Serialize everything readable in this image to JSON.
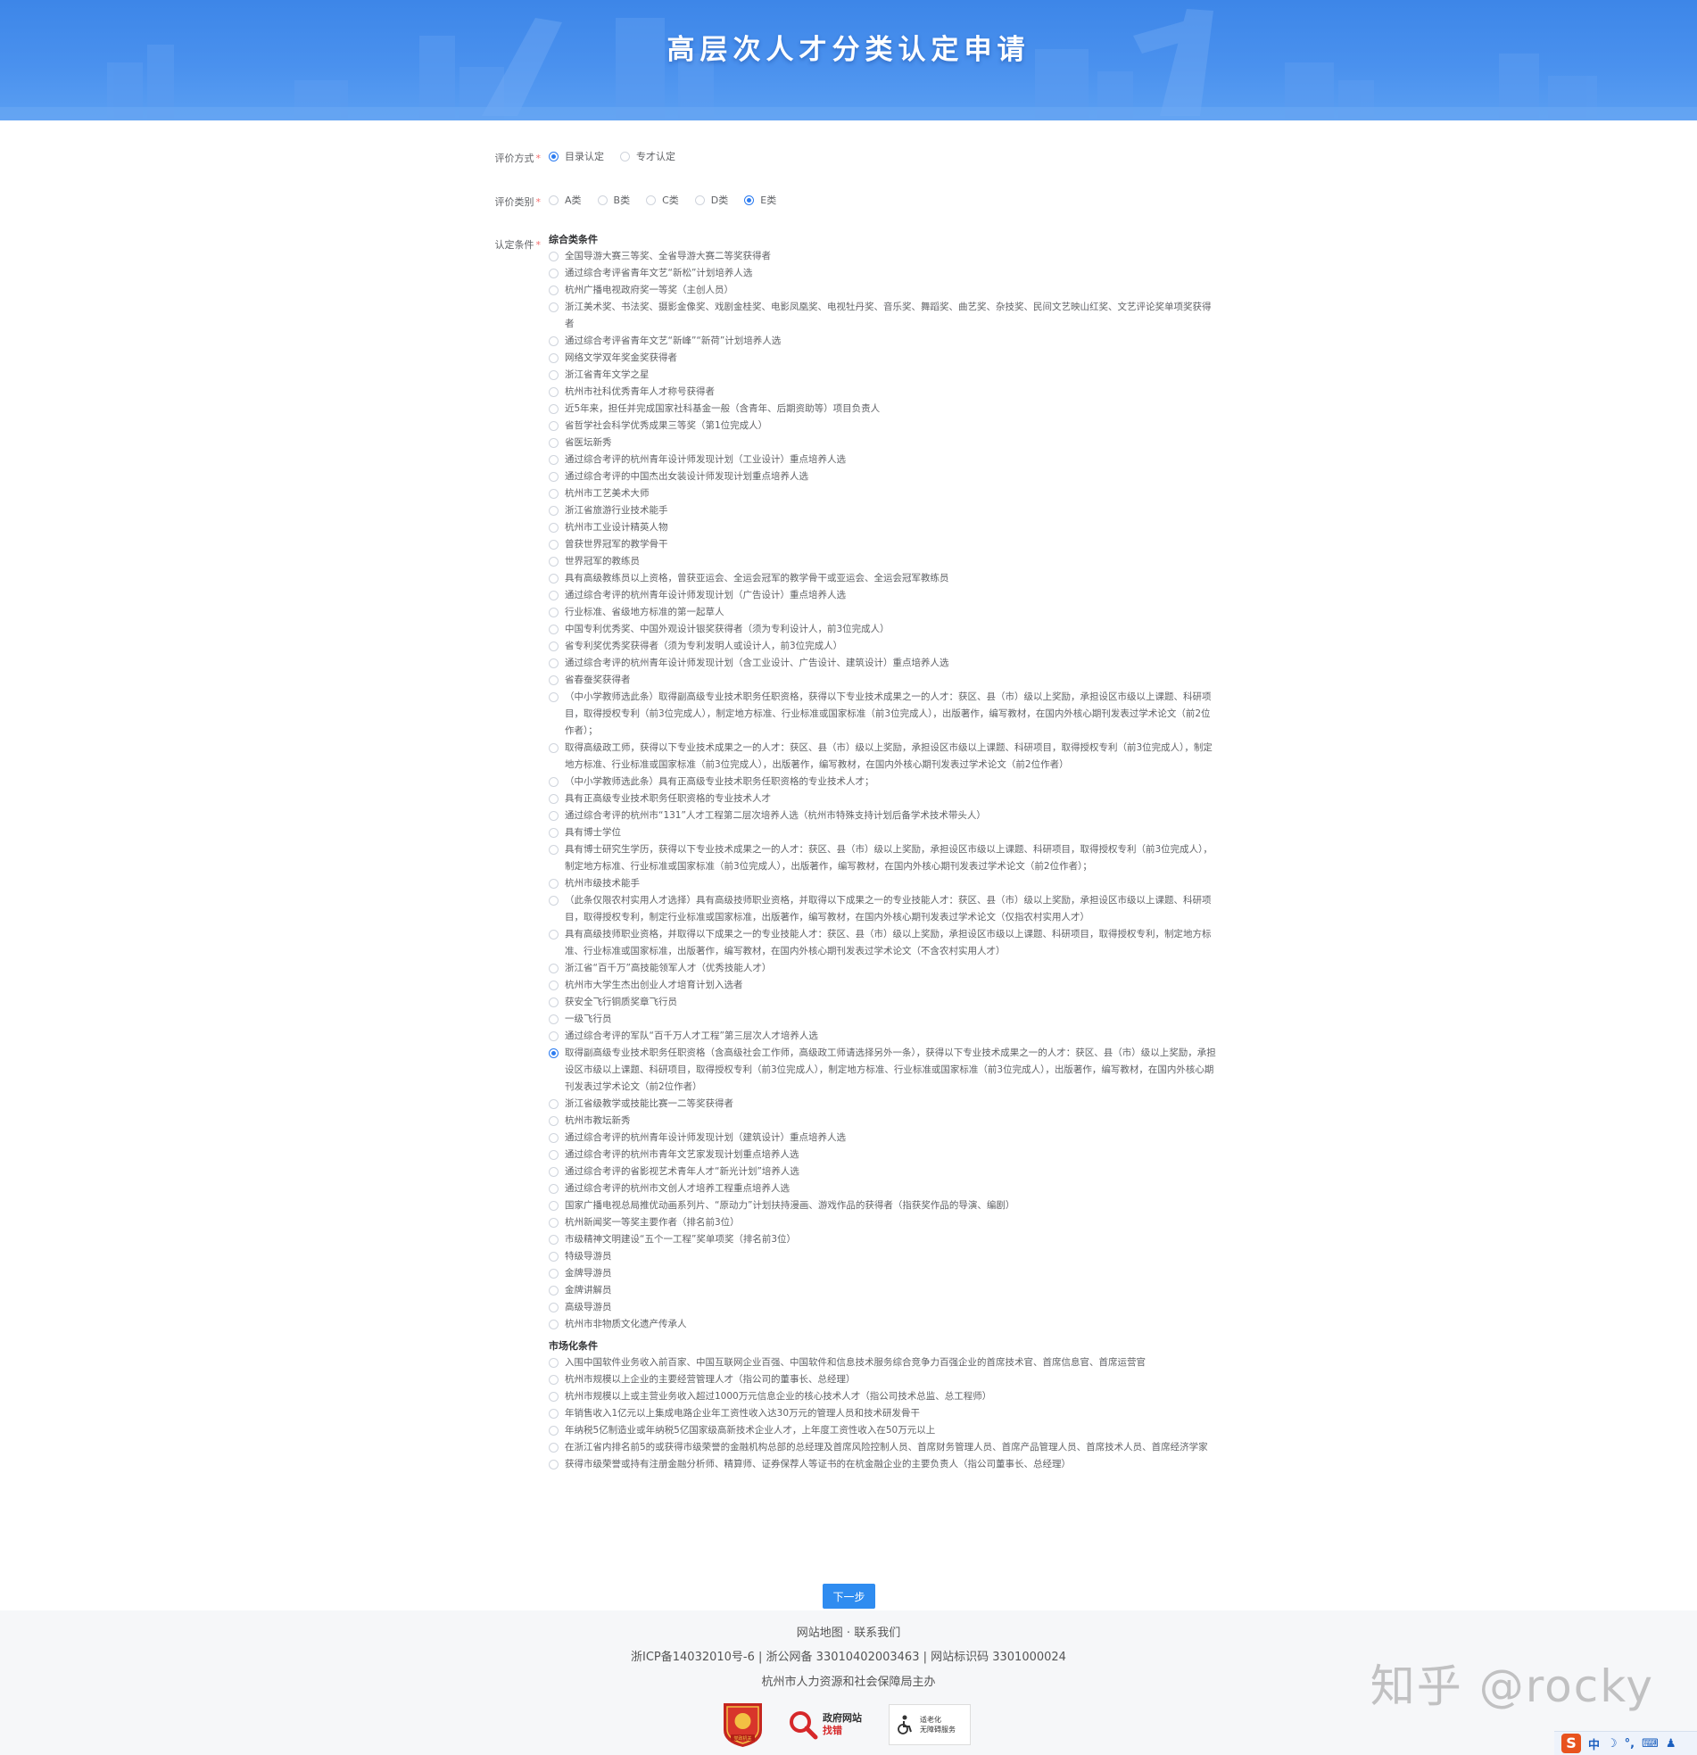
{
  "page_title": "高层次人才分类认定申请",
  "form": {
    "method": {
      "label": "评价方式",
      "required_mark": "*",
      "options": [
        {
          "label": "目录认定",
          "selected": true
        },
        {
          "label": "专才认定",
          "selected": false
        }
      ]
    },
    "category": {
      "label": "评价类别",
      "required_mark": "*",
      "options": [
        {
          "label": "A类",
          "selected": false
        },
        {
          "label": "B类",
          "selected": false
        },
        {
          "label": "C类",
          "selected": false
        },
        {
          "label": "D类",
          "selected": false
        },
        {
          "label": "E类",
          "selected": true
        }
      ]
    },
    "conditions": {
      "label": "认定条件",
      "required_mark": "*",
      "groups": [
        {
          "title": "综合类条件",
          "items": [
            {
              "text": "全国导游大赛三等奖、全省导游大赛二等奖获得者",
              "selected": false
            },
            {
              "text": "通过综合考评省青年文艺“新松”计划培养人选",
              "selected": false
            },
            {
              "text": "杭州广播电视政府奖一等奖（主创人员）",
              "selected": false
            },
            {
              "text": "浙江美术奖、书法奖、摄影金像奖、戏剧金桂奖、电影凤凰奖、电视牡丹奖、音乐奖、舞蹈奖、曲艺奖、杂技奖、民间文艺映山红奖、文艺评论奖单项奖获得者",
              "selected": false
            },
            {
              "text": "通过综合考评省青年文艺“新峰”“新荷”计划培养人选",
              "selected": false
            },
            {
              "text": "网络文学双年奖金奖获得者",
              "selected": false
            },
            {
              "text": "浙江省青年文学之星",
              "selected": false
            },
            {
              "text": "杭州市社科优秀青年人才称号获得者",
              "selected": false
            },
            {
              "text": "近5年来，担任并完成国家社科基金一般（含青年、后期资助等）项目负责人",
              "selected": false
            },
            {
              "text": "省哲学社会科学优秀成果三等奖（第1位完成人）",
              "selected": false
            },
            {
              "text": "省医坛新秀",
              "selected": false
            },
            {
              "text": "通过综合考评的杭州青年设计师发现计划（工业设计）重点培养人选",
              "selected": false
            },
            {
              "text": "通过综合考评的中国杰出女装设计师发现计划重点培养人选",
              "selected": false
            },
            {
              "text": "杭州市工艺美术大师",
              "selected": false
            },
            {
              "text": "浙江省旅游行业技术能手",
              "selected": false
            },
            {
              "text": "杭州市工业设计精英人物",
              "selected": false
            },
            {
              "text": "曾获世界冠军的教学骨干",
              "selected": false
            },
            {
              "text": "世界冠军的教练员",
              "selected": false
            },
            {
              "text": "具有高级教练员以上资格，曾获亚运会、全运会冠军的教学骨干或亚运会、全运会冠军教练员",
              "selected": false
            },
            {
              "text": "通过综合考评的杭州青年设计师发现计划（广告设计）重点培养人选",
              "selected": false
            },
            {
              "text": "行业标准、省级地方标准的第一起草人",
              "selected": false
            },
            {
              "text": "中国专利优秀奖、中国外观设计银奖获得者（须为专利设计人，前3位完成人）",
              "selected": false
            },
            {
              "text": "省专利奖优秀奖获得者（须为专利发明人或设计人，前3位完成人）",
              "selected": false
            },
            {
              "text": "通过综合考评的杭州青年设计师发现计划（含工业设计、广告设计、建筑设计）重点培养人选",
              "selected": false
            },
            {
              "text": "省春蚕奖获得者",
              "selected": false
            },
            {
              "text": "（中小学教师选此条）取得副高级专业技术职务任职资格，获得以下专业技术成果之一的人才：获区、县（市）级以上奖励，承担设区市级以上课题、科研项目，取得授权专利（前3位完成人），制定地方标准、行业标准或国家标准（前3位完成人），出版著作，编写教材，在国内外核心期刊发表过学术论文（前2位作者）；",
              "selected": false
            },
            {
              "text": "取得高级政工师，获得以下专业技术成果之一的人才：获区、县（市）级以上奖励，承担设区市级以上课题、科研项目，取得授权专利（前3位完成人），制定地方标准、行业标准或国家标准（前3位完成人），出版著作，编写教材，在国内外核心期刊发表过学术论文（前2位作者）",
              "selected": false
            },
            {
              "text": "（中小学教师选此条）具有正高级专业技术职务任职资格的专业技术人才；",
              "selected": false
            },
            {
              "text": "具有正高级专业技术职务任职资格的专业技术人才",
              "selected": false
            },
            {
              "text": "通过综合考评的杭州市“131”人才工程第二层次培养人选（杭州市特殊支持计划后备学术技术带头人）",
              "selected": false
            },
            {
              "text": "具有博士学位",
              "selected": false
            },
            {
              "text": "具有博士研究生学历，获得以下专业技术成果之一的人才：获区、县（市）级以上奖励，承担设区市级以上课题、科研项目，取得授权专利（前3位完成人），制定地方标准、行业标准或国家标准（前3位完成人），出版著作，编写教材，在国内外核心期刊发表过学术论文（前2位作者）；",
              "selected": false
            },
            {
              "text": "杭州市级技术能手",
              "selected": false
            },
            {
              "text": "（此条仅限农村实用人才选择）具有高级技师职业资格，并取得以下成果之一的专业技能人才：获区、县（市）级以上奖励，承担设区市级以上课题、科研项目，取得授权专利，制定行业标准或国家标准，出版著作，编写教材，在国内外核心期刊发表过学术论文（仅指农村实用人才）",
              "selected": false
            },
            {
              "text": "具有高级技师职业资格，并取得以下成果之一的专业技能人才：获区、县（市）级以上奖励，承担设区市级以上课题、科研项目，取得授权专利，制定地方标准、行业标准或国家标准，出版著作，编写教材，在国内外核心期刊发表过学术论文（不含农村实用人才）",
              "selected": false
            },
            {
              "text": "浙江省“百千万”高技能领军人才（优秀技能人才）",
              "selected": false
            },
            {
              "text": "杭州市大学生杰出创业人才培育计划入选者",
              "selected": false
            },
            {
              "text": "获安全飞行铜质奖章飞行员",
              "selected": false
            },
            {
              "text": "一级飞行员",
              "selected": false
            },
            {
              "text": "通过综合考评的军队“百千万人才工程”第三层次人才培养人选",
              "selected": false
            },
            {
              "text": "取得副高级专业技术职务任职资格（含高级社会工作师，高级政工师请选择另外一条），获得以下专业技术成果之一的人才：获区、县（市）级以上奖励，承担设区市级以上课题、科研项目，取得授权专利（前3位完成人），制定地方标准、行业标准或国家标准（前3位完成人），出版著作，编写教材，在国内外核心期刊发表过学术论文（前2位作者）",
              "selected": true
            },
            {
              "text": "浙江省级教学或技能比赛一二等奖获得者",
              "selected": false
            },
            {
              "text": "杭州市教坛新秀",
              "selected": false
            },
            {
              "text": "通过综合考评的杭州青年设计师发现计划（建筑设计）重点培养人选",
              "selected": false
            },
            {
              "text": "通过综合考评的杭州市青年文艺家发现计划重点培养人选",
              "selected": false
            },
            {
              "text": "通过综合考评的省影视艺术青年人才“新光计划”培养人选",
              "selected": false
            },
            {
              "text": "通过综合考评的杭州市文创人才培养工程重点培养人选",
              "selected": false
            },
            {
              "text": "国家广播电视总局推优动画系列片、“原动力”计划扶持漫画、游戏作品的获得者（指获奖作品的导演、编剧）",
              "selected": false
            },
            {
              "text": "杭州新闻奖一等奖主要作者（排名前3位）",
              "selected": false
            },
            {
              "text": "市级精神文明建设“五个一工程”奖单项奖（排名前3位）",
              "selected": false
            },
            {
              "text": "特级导游员",
              "selected": false
            },
            {
              "text": "金牌导游员",
              "selected": false
            },
            {
              "text": "金牌讲解员",
              "selected": false
            },
            {
              "text": "高级导游员",
              "selected": false
            },
            {
              "text": "杭州市非物质文化遗产传承人",
              "selected": false
            }
          ]
        },
        {
          "title": "市场化条件",
          "items": [
            {
              "text": "入围中国软件业务收入前百家、中国互联网企业百强、中国软件和信息技术服务综合竞争力百强企业的首席技术官、首席信息官、首席运营官",
              "selected": false
            },
            {
              "text": "杭州市规模以上企业的主要经营管理人才（指公司的董事长、总经理）",
              "selected": false
            },
            {
              "text": "杭州市规模以上或主营业务收入超过1000万元信息企业的核心技术人才（指公司技术总监、总工程师）",
              "selected": false
            },
            {
              "text": "年销售收入1亿元以上集成电路企业年工资性收入达30万元的管理人员和技术研发骨干",
              "selected": false
            },
            {
              "text": "年纳税5亿制造业或年纳税5亿国家级高新技术企业人才，上年度工资性收入在50万元以上",
              "selected": false
            },
            {
              "text": "在浙江省内排名前5的或获得市级荣誉的金融机构总部的总经理及首席风险控制人员、首席财务管理人员、首席产品管理人员、首席技术人员、首席经济学家",
              "selected": false
            },
            {
              "text": "获得市级荣誉或持有注册金融分析师、精算师、证券保荐人等证书的在杭金融企业的主要负责人（指公司董事长、总经理）",
              "selected": false
            }
          ]
        }
      ]
    },
    "next_button": "下一步"
  },
  "footer": {
    "links": "网站地图 · 联系我们",
    "icp": "浙ICP备14032010号-6 | 浙公网备 33010402003463 | 网站标识码 3301000024",
    "host": "杭州市人力资源和社会保障局主办",
    "badge_gov_line1": "政府网站",
    "badge_gov_line2": "找错",
    "badge_access_line1": "适老化",
    "badge_access_line2": "无障碍服务",
    "badge_party": "党政机关"
  },
  "watermark": "知乎 @rocky",
  "taskbar": {
    "ime_label": "中"
  },
  "colors": {
    "primary": "#2f8cf0",
    "banner": "#4a91ee",
    "required": "#f56c6c"
  }
}
